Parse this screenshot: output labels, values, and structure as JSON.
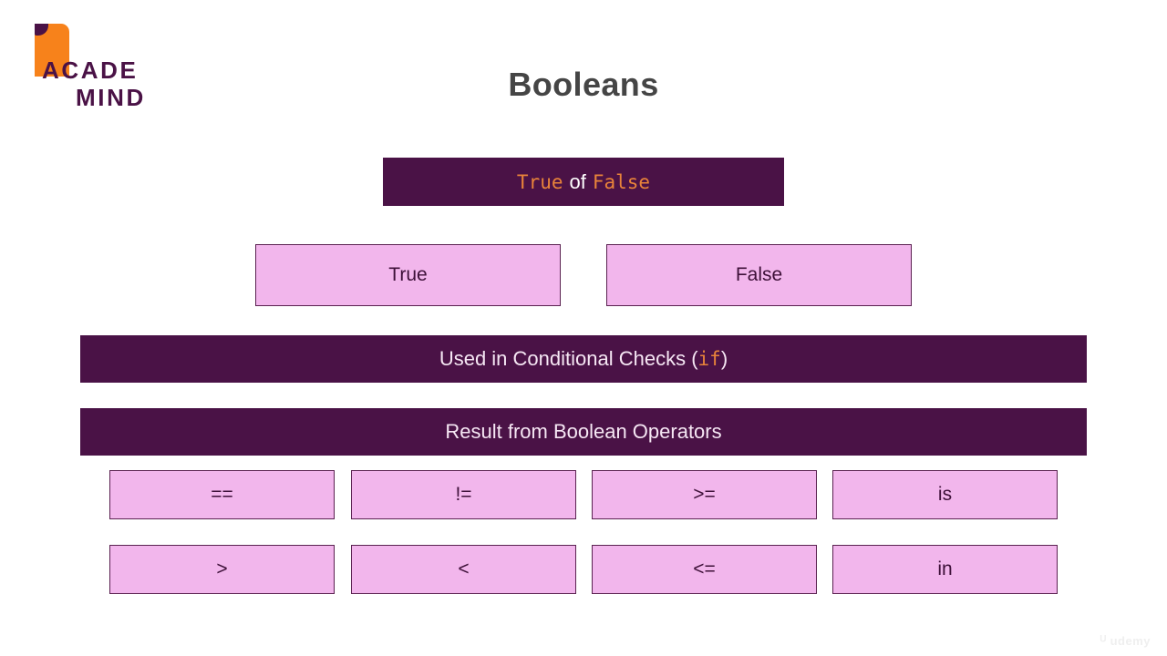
{
  "slide": {
    "title": "Booleans",
    "background_color": "#FFFFFF",
    "dark_color": "#4A1246",
    "pink_color": "#F2B6EC",
    "orange_color": "#E8833A",
    "title_color": "#454545"
  },
  "logo": {
    "line1": "ACADE",
    "line2": "MIND",
    "mark_name": "academind-flag-logo",
    "mark_color": "#F7821B",
    "text_color": "#4A1246"
  },
  "banner_true_or_false": {
    "code_left": "True",
    "connector": "of",
    "code_right": "False"
  },
  "value_boxes": [
    {
      "label": "True"
    },
    {
      "label": "False"
    }
  ],
  "banner_conditional": {
    "text_before": "Used in Conditional Checks (",
    "code": "if",
    "text_after": ")"
  },
  "banner_operators": {
    "text": "Result from Boolean Operators"
  },
  "operators": {
    "row1": [
      {
        "label": "=="
      },
      {
        "label": "!="
      },
      {
        "label": ">="
      },
      {
        "label": "is"
      }
    ],
    "row2": [
      {
        "label": ">"
      },
      {
        "label": "<"
      },
      {
        "label": "<="
      },
      {
        "label": "in"
      }
    ]
  },
  "watermark": {
    "mark": "ᵁ",
    "text": "udemy"
  }
}
